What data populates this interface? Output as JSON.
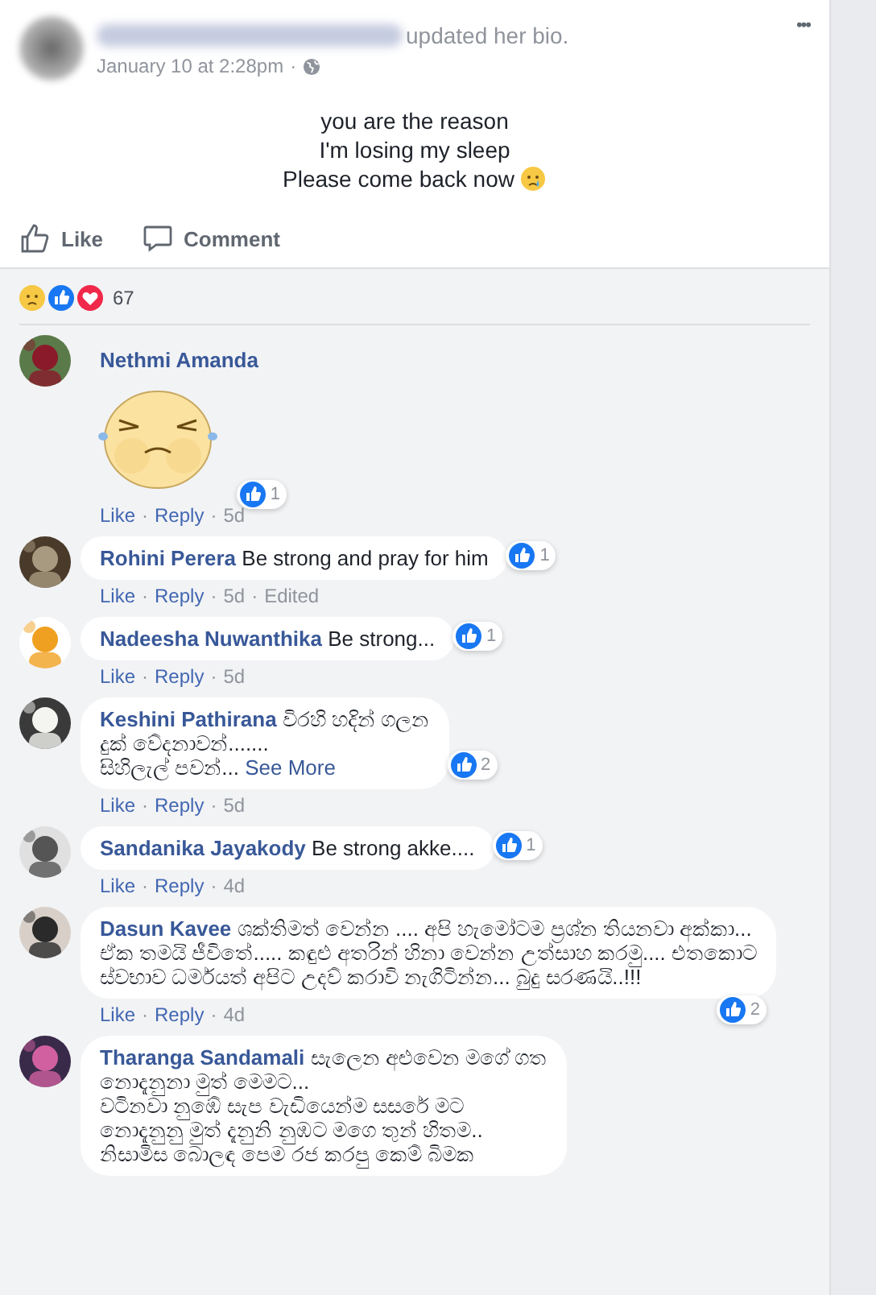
{
  "post": {
    "action": "updated her bio.",
    "time": "January 10 at 2:28pm",
    "separator": "·",
    "more": "•••",
    "bio_lines": [
      "you are the reason",
      "I'm losing my sleep",
      "Please come back now"
    ],
    "buttons": [
      "Like",
      "Comment"
    ],
    "reaction_count": "67"
  },
  "link_separator": "·",
  "comments": [
    {
      "kind": "sticker",
      "name": "Nethmi Amanda",
      "likes": "1",
      "actions": [
        "Like",
        "Reply"
      ],
      "time": "5d"
    },
    {
      "kind": "text",
      "name": "Rohini Perera",
      "text": "Be strong and pray for him",
      "likes": "1",
      "actions": [
        "Like",
        "Reply"
      ],
      "time": "5d",
      "edited": "Edited"
    },
    {
      "kind": "text",
      "name": "Nadeesha Nuwanthika",
      "text": "Be strong...",
      "likes": "1",
      "actions": [
        "Like",
        "Reply"
      ],
      "time": "5d"
    },
    {
      "kind": "text",
      "name": "Keshini Pathirana",
      "text": "විරහි හදින් ගලන\nදුක් වේදනාවන්.......\nසිහිලැල් පවන්...",
      "see_more": "See More",
      "likes": "2",
      "actions": [
        "Like",
        "Reply"
      ],
      "time": "5d"
    },
    {
      "kind": "text",
      "name": "Sandanika Jayakody",
      "text": "Be strong akke....",
      "likes": "1",
      "actions": [
        "Like",
        "Reply"
      ],
      "time": "4d"
    },
    {
      "kind": "text",
      "name": "Dasun Kavee",
      "text": "ශක්තිමත් වෙන්න .... අපි හැමෝටම ප්‍රශ්න තියනවා අක්කා...\nඒක තමයි ජීවිතේ..... කඳුළු අතරින් හිනා වෙන්න උත්සාහ කරමු.... එතකොට\nස්වභාව ධර්මයත් අපිට උදව් කරාවි නැගිටින්න... බුදු සරණයි..!!!",
      "likes": "2",
      "actions": [
        "Like",
        "Reply"
      ],
      "time": "4d"
    },
    {
      "kind": "text",
      "name": "Tharanga Sandamali",
      "text": "සැලෙන අළුවෙන මගේ ගත\nනොදැනුනා මුත් මෙමට...\nවටිනවා නුඹේ සැප වැඩියෙන්ම සසරේ මට\nනොදැනුනු මුත් දැනුනි නුඹට මගෙ තුන් හිතම..\nනිසාමිස බොලඳ පෙම රජ කරපු කෙම් බිමක"
    }
  ]
}
